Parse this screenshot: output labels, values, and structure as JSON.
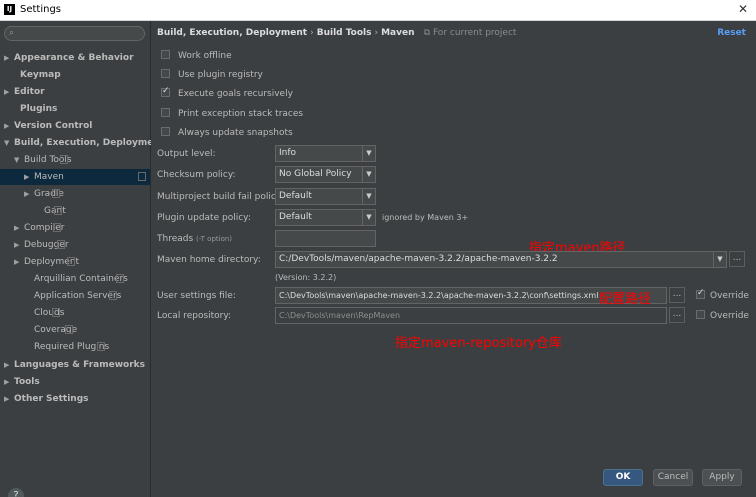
{
  "window": {
    "title": "Settings",
    "app_icon_text": "IJ",
    "close_glyph": "✕"
  },
  "sidebar": {
    "search_placeholder": "",
    "items": [
      {
        "label": "Appearance & Behavior",
        "arrow": "▶",
        "bold": true
      },
      {
        "label": "Keymap",
        "arrow": "",
        "bold": true
      },
      {
        "label": "Editor",
        "arrow": "▶",
        "bold": true
      },
      {
        "label": "Plugins",
        "arrow": "",
        "bold": true
      },
      {
        "label": "Version Control",
        "arrow": "▶",
        "bold": true
      },
      {
        "label": "Build, Execution, Deployment",
        "arrow": "▼",
        "bold": true
      },
      {
        "label": "Build Tools",
        "arrow": "▼"
      },
      {
        "label": "Maven",
        "arrow": "▶",
        "selected": true
      },
      {
        "label": "Gradle",
        "arrow": "▶"
      },
      {
        "label": "Gant",
        "arrow": ""
      },
      {
        "label": "Compiler",
        "arrow": "▶"
      },
      {
        "label": "Debugger",
        "arrow": "▶"
      },
      {
        "label": "Deployment",
        "arrow": "▶"
      },
      {
        "label": "Arquillian Containers",
        "arrow": ""
      },
      {
        "label": "Application Servers",
        "arrow": ""
      },
      {
        "label": "Clouds",
        "arrow": ""
      },
      {
        "label": "Coverage",
        "arrow": ""
      },
      {
        "label": "Required Plugins",
        "arrow": ""
      },
      {
        "label": "Languages & Frameworks",
        "arrow": "▶",
        "bold": true
      },
      {
        "label": "Tools",
        "arrow": "▶",
        "bold": true
      },
      {
        "label": "Other Settings",
        "arrow": "▶",
        "bold": true
      }
    ],
    "help_glyph": "?"
  },
  "breadcrumb": {
    "parts": [
      "Build, Execution, Deployment",
      "Build Tools",
      "Maven"
    ],
    "separator": "›",
    "scope": "For current project"
  },
  "reset_label": "Reset",
  "checkboxes": [
    {
      "label": "Work offline",
      "checked": false
    },
    {
      "label": "Use plugin registry",
      "checked": false
    },
    {
      "label": "Execute goals recursively",
      "checked": true
    },
    {
      "label": "Print exception stack traces",
      "checked": false
    },
    {
      "label": "Always update snapshots",
      "checked": false
    }
  ],
  "form": {
    "output_level": {
      "label": "Output level:",
      "value": "Info"
    },
    "checksum_policy": {
      "label": "Checksum policy:",
      "value": "No Global Policy"
    },
    "multiproject_fail": {
      "label": "Multiproject build fail policy:",
      "value": "Default"
    },
    "plugin_update": {
      "label": "Plugin update policy:",
      "value": "Default",
      "note": "ignored by Maven 3+"
    },
    "threads": {
      "label": "Threads",
      "sub": "(-T option)",
      "value": ""
    },
    "maven_home": {
      "label": "Maven home directory:",
      "value": "C:/DevTools/maven/apache-maven-3.2.2/apache-maven-3.2.2",
      "version": "(Version: 3.2.2)"
    },
    "user_settings": {
      "label": "User settings file:",
      "value": "C:\\DevTools\\maven\\apache-maven-3.2.2\\apache-maven-3.2.2\\conf\\settings.xml",
      "override_label": "Override",
      "override_checked": true
    },
    "local_repo": {
      "label": "Local repository:",
      "value": "C:\\DevTools\\maven\\RepMaven",
      "override_label": "Override",
      "override_checked": false
    }
  },
  "annotations": {
    "maven_path": "指定maven路径",
    "config_path": "配置路径",
    "repository": "指定maven-repository仓库"
  },
  "buttons": {
    "ok": "OK",
    "cancel": "Cancel",
    "apply": "Apply",
    "browse": "..."
  },
  "colors": {
    "background": "#3c3f41",
    "selection": "#0d293e",
    "accent": "#589df6",
    "annotation": "#ff0000"
  }
}
